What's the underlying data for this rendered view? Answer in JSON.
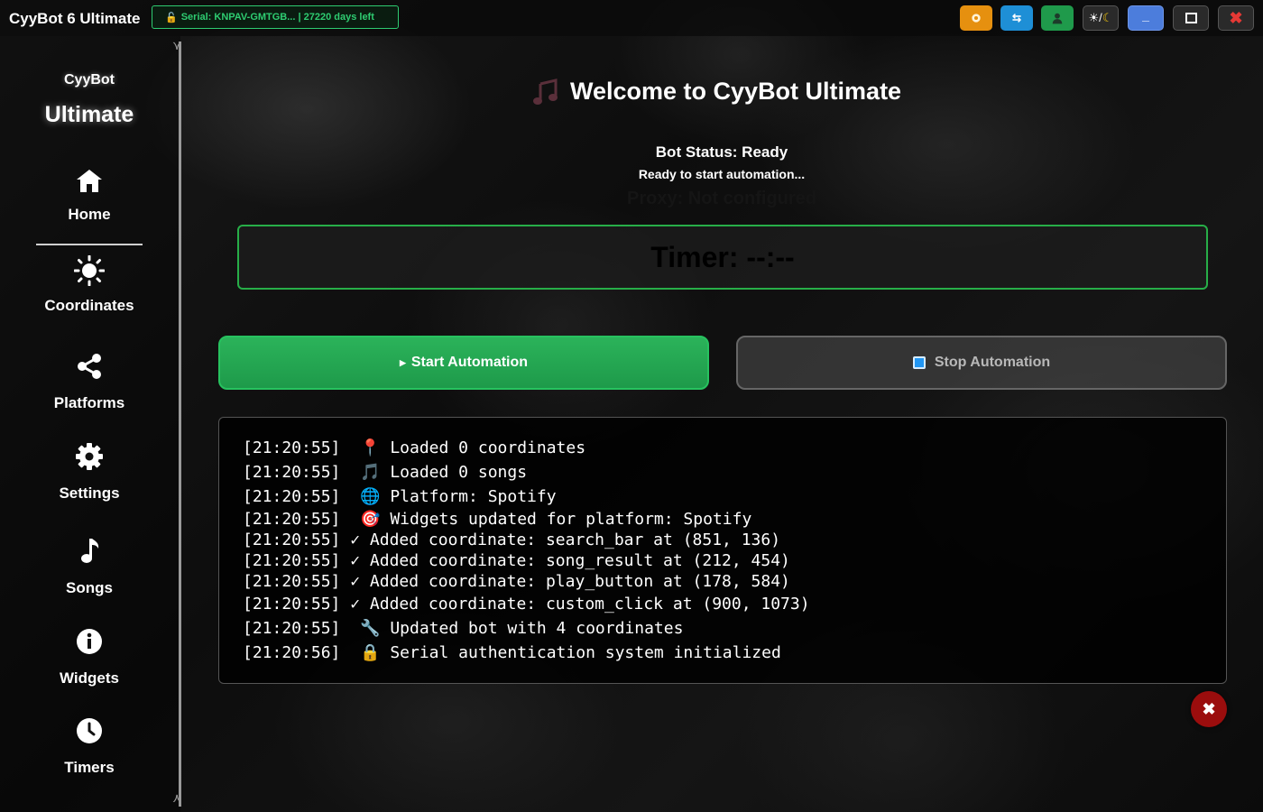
{
  "window": {
    "title": "CyyBot 6 Ultimate",
    "serial_lock_icon": "🔓",
    "serial_text": "Serial: KNPAV-GMTGB... | 27220 days left",
    "controls": [
      {
        "name": "settings-gear",
        "glyph": "⚙",
        "color": "#e6900f"
      },
      {
        "name": "refresh",
        "glyph": "⇆",
        "color": "#1e8fd6"
      },
      {
        "name": "user",
        "glyph": "👤",
        "color": "#1f9a4b"
      },
      {
        "name": "theme-toggle",
        "glyph": "☀/🌙",
        "color": "#2a2a2a"
      },
      {
        "name": "minimize",
        "glyph": "_",
        "color": "#4c7ddc"
      },
      {
        "name": "maximize",
        "glyph": "□",
        "color": "#2a2a2a"
      },
      {
        "name": "close",
        "glyph": "✖",
        "color": "#2a2a2a"
      }
    ]
  },
  "sidebar": {
    "brand_small": "CyyBot",
    "brand_big": "Ultimate",
    "items": [
      {
        "label": "Home",
        "icon": "home-icon"
      },
      {
        "label": "Coordinates",
        "icon": "sun-icon"
      },
      {
        "label": "Platforms",
        "icon": "share-icon"
      },
      {
        "label": "Settings",
        "icon": "gear-icon"
      },
      {
        "label": "Songs",
        "icon": "music-note-icon"
      },
      {
        "label": "Widgets",
        "icon": "info-icon"
      },
      {
        "label": "Timers",
        "icon": "clock-icon"
      }
    ]
  },
  "main": {
    "welcome": "Welcome to CyyBot Ultimate",
    "bot_status": "Bot Status: Ready",
    "status_detail": "Ready to start automation...",
    "proxy": "Proxy: Not configured",
    "timer": "Timer: --:--",
    "start_label": "Start Automation",
    "stop_label": "Stop Automation",
    "log": [
      {
        "time": "[21:20:55]",
        "icon": "📍",
        "text": "Loaded 0 coordinates"
      },
      {
        "time": "[21:20:55]",
        "icon": "🎵",
        "text": "Loaded 0 songs"
      },
      {
        "time": "[21:20:55]",
        "icon": "🌐",
        "text": "Platform: Spotify"
      },
      {
        "time": "[21:20:55]",
        "icon": "🎯",
        "text": "Widgets updated for platform: Spotify"
      },
      {
        "time": "[21:20:55]",
        "icon": "✓",
        "text": "Added coordinate: search_bar at (851, 136)"
      },
      {
        "time": "[21:20:55]",
        "icon": "✓",
        "text": "Added coordinate: song_result at (212, 454)"
      },
      {
        "time": "[21:20:55]",
        "icon": "✓",
        "text": "Added coordinate: play_button at (178, 584)"
      },
      {
        "time": "[21:20:55]",
        "icon": "✓",
        "text": "Added coordinate: custom_click at (900, 1073)"
      },
      {
        "time": "[21:20:55]",
        "icon": "🔧",
        "text": "Updated bot with 4 coordinates"
      },
      {
        "time": "[21:20:56]",
        "icon": "🔒",
        "text": "Serial authentication system initialized"
      }
    ]
  }
}
